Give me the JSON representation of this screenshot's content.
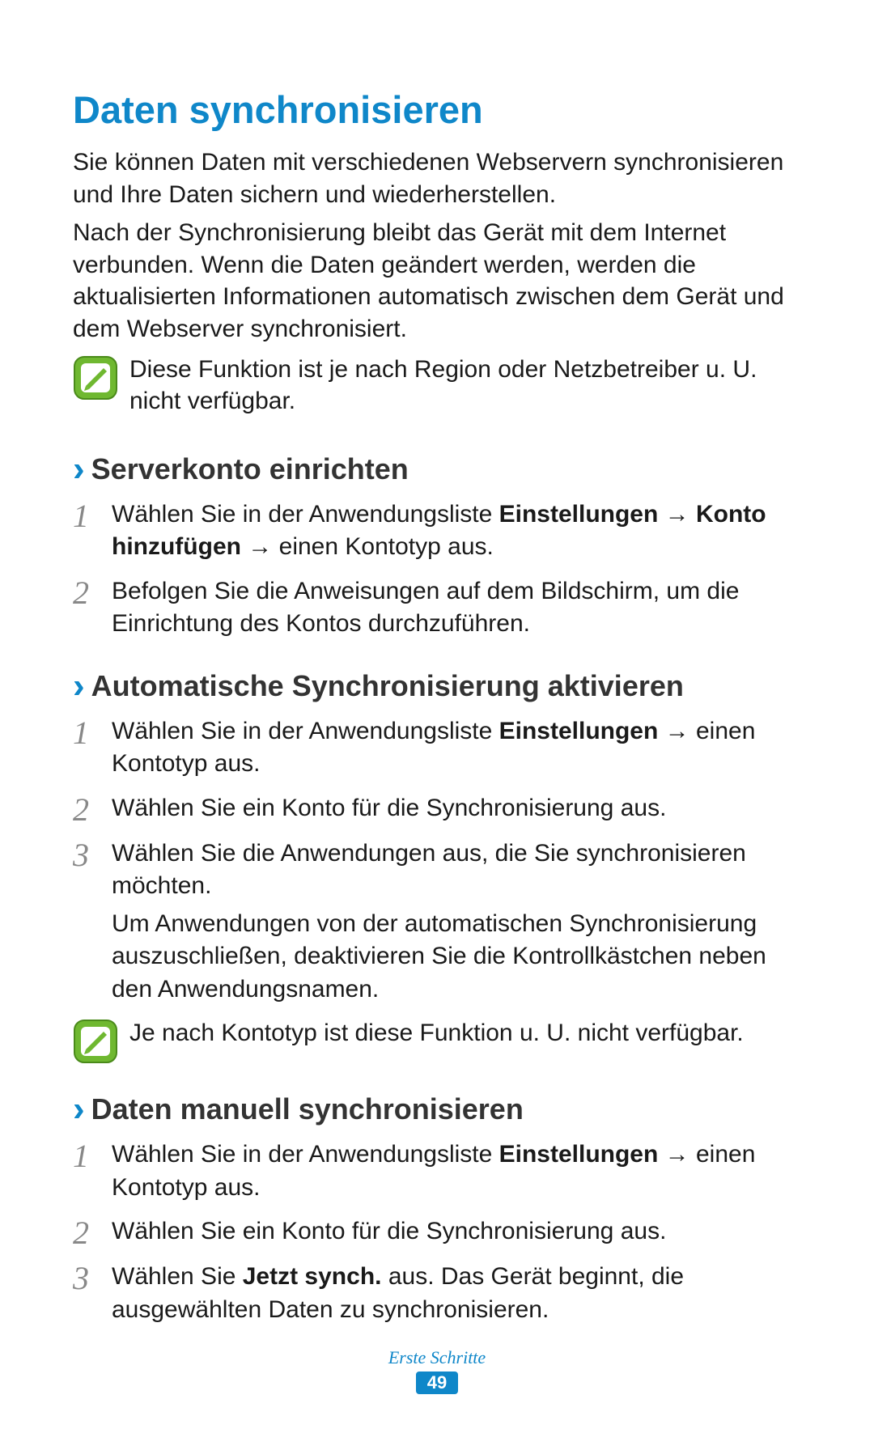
{
  "title": "Daten synchronisieren",
  "intro": [
    "Sie können Daten mit verschiedenen Webservern synchronisieren und Ihre Daten sichern und wiederherstellen.",
    "Nach der Synchronisierung bleibt das Gerät mit dem Internet verbunden. Wenn die Daten geändert werden, werden die aktualisierten Informationen automatisch zwischen dem Gerät und dem Webserver synchronisiert."
  ],
  "note_top": "Diese Funktion ist je nach Region oder Netzbetreiber u. U. nicht verfügbar.",
  "sections": {
    "s1": {
      "heading": "Serverkonto einrichten",
      "step1_pre": "Wählen Sie in der Anwendungsliste ",
      "step1_b1": "Einstellungen",
      "step1_arrow1": " → ",
      "step1_b2": "Konto hinzufügen",
      "step1_arrow2": " → ",
      "step1_post": "einen Kontotyp aus.",
      "step2": "Befolgen Sie die Anweisungen auf dem Bildschirm, um die Einrichtung des Kontos durchzuführen."
    },
    "s2": {
      "heading": "Automatische Synchronisierung aktivieren",
      "step1_pre": "Wählen Sie in der Anwendungsliste ",
      "step1_b1": "Einstellungen",
      "step1_arrow1": " → ",
      "step1_post": "einen Kontotyp aus.",
      "step2": "Wählen Sie ein Konto für die Synchronisierung aus.",
      "step3": "Wählen Sie die Anwendungen aus, die Sie synchronisieren möchten.",
      "step3_extra": "Um Anwendungen von der automatischen Synchronisierung auszuschließen, deaktivieren Sie die Kontrollkästchen neben den Anwendungsnamen.",
      "note": "Je nach Kontotyp ist diese Funktion u. U. nicht verfügbar."
    },
    "s3": {
      "heading": "Daten manuell synchronisieren",
      "step1_pre": "Wählen Sie in der Anwendungsliste ",
      "step1_b1": "Einstellungen",
      "step1_arrow1": " → ",
      "step1_post": "einen Kontotyp aus.",
      "step2": "Wählen Sie ein Konto für die Synchronisierung aus.",
      "step3_pre": "Wählen Sie ",
      "step3_b1": "Jetzt synch.",
      "step3_post": " aus. Das Gerät beginnt, die ausgewählten Daten zu synchronisieren."
    }
  },
  "numbers": {
    "n1": "1",
    "n2": "2",
    "n3": "3"
  },
  "chevron": "›",
  "footer": {
    "label": "Erste Schritte",
    "page": "49"
  }
}
